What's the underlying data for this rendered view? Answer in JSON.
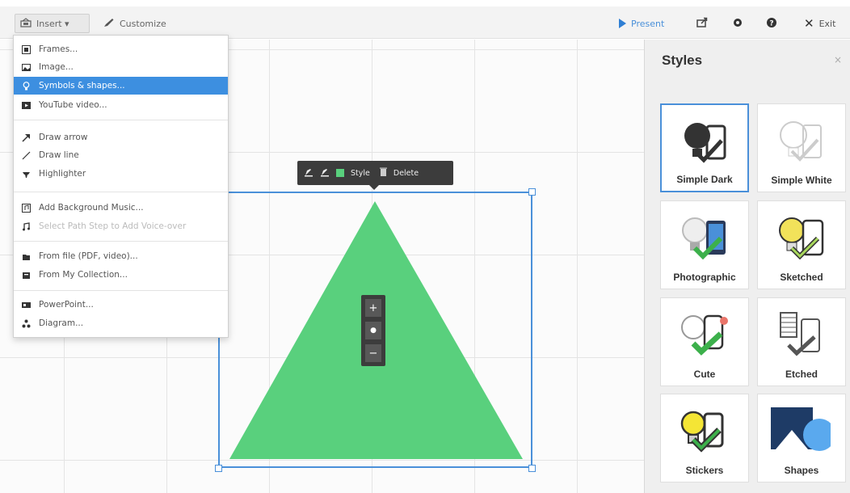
{
  "toolbar": {
    "insert_label": "Insert ▾",
    "customize_label": "Customize",
    "present_label": "Present",
    "exit_label": "Exit"
  },
  "menu": {
    "items": [
      {
        "label": "Frames...",
        "icon": "frame-icon"
      },
      {
        "label": "Image...",
        "icon": "image-icon"
      },
      {
        "label": "Symbols & shapes...",
        "icon": "lightbulb-icon",
        "active": true
      },
      {
        "label": "YouTube video...",
        "icon": "youtube-icon"
      },
      {
        "label": "Draw arrow",
        "icon": "arrow-icon"
      },
      {
        "label": "Draw line",
        "icon": "line-icon"
      },
      {
        "label": "Highlighter",
        "icon": "highlighter-icon"
      },
      {
        "label": "Add Background Music...",
        "icon": "music-box-icon"
      },
      {
        "label": "Select Path Step to Add Voice-over",
        "icon": "music-note-icon",
        "disabled": true
      },
      {
        "label": "From file (PDF, video)...",
        "icon": "file-icon"
      },
      {
        "label": "From My Collection...",
        "icon": "collection-icon"
      },
      {
        "label": "PowerPoint...",
        "icon": "powerpoint-icon"
      },
      {
        "label": "Diagram...",
        "icon": "diagram-icon"
      }
    ]
  },
  "context_toolbar": {
    "style_label": "Style",
    "delete_label": "Delete"
  },
  "zoom": {
    "plus": "+",
    "center": "●",
    "minus": "−"
  },
  "panel": {
    "title": "Styles",
    "close": "×",
    "tiles": [
      {
        "label": "Simple Dark",
        "selected": true
      },
      {
        "label": "Simple White"
      },
      {
        "label": "Photographic"
      },
      {
        "label": "Sketched"
      },
      {
        "label": "Cute"
      },
      {
        "label": "Etched"
      },
      {
        "label": "Stickers"
      },
      {
        "label": "Shapes"
      }
    ]
  },
  "colors": {
    "accent": "#3d8fe0",
    "shape_fill": "#59d07d",
    "selection": "#4a90d9"
  }
}
